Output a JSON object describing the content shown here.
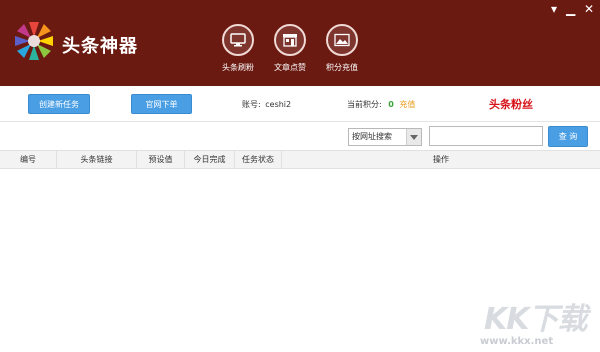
{
  "window": {
    "minimize_symbol": "▁",
    "close_symbol": "✕",
    "menu_symbol": "▾"
  },
  "app": {
    "title": "头条神器",
    "logo_icon": "colorful-star-flower"
  },
  "nav": [
    {
      "label": "头条刷粉",
      "icon": "monitor-icon"
    },
    {
      "label": "文章点赞",
      "icon": "storefront-icon"
    },
    {
      "label": "积分充值",
      "icon": "landscape-image-icon"
    }
  ],
  "toolbar": {
    "create_task_label": "创建新任务",
    "official_order_label": "官网下单",
    "account_label": "账号:",
    "account_value": "ceshi2",
    "points_label": "当前积分:",
    "points_value": "0",
    "recharge_label": "充值",
    "fans_title": "头条粉丝"
  },
  "search": {
    "select_value": "按网址搜索",
    "input_value": "",
    "search_label": "查 询"
  },
  "table": {
    "columns": [
      "编号",
      "头条链接",
      "预设值",
      "今日完成",
      "任务状态",
      "操作"
    ]
  },
  "watermark": {
    "logo": "KK下载",
    "url": "www.kkx.net"
  },
  "colors": {
    "header_bg": "#6b1a12",
    "button_blue": "#4a9ee4",
    "fans_red": "#d8141b",
    "points_green": "#3aa03a",
    "recharge_orange": "#e89a1a"
  }
}
